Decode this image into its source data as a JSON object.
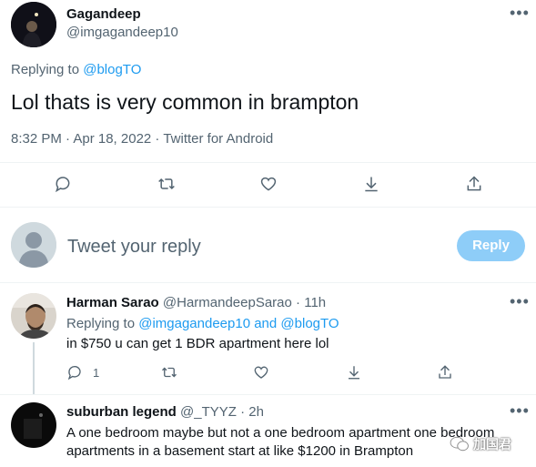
{
  "main_tweet": {
    "display_name": "Gagandeep",
    "handle": "@imgagandeep10",
    "replying_prefix": "Replying to",
    "replying_to": "@blogTO",
    "text": "Lol thats is very common in brampton",
    "meta": "8:32 PM · Apr 18, 2022 · Twitter for Android"
  },
  "composer": {
    "placeholder": "Tweet your reply",
    "button_label": "Reply"
  },
  "replies": [
    {
      "display_name": "Harman Sarao",
      "handle": "@HarmandeepSarao",
      "time": "· 11h",
      "replying_prefix": "Replying to",
      "replying_to_1": "@imgagandeep10",
      "replying_and": "and",
      "replying_to_2": "@blogTO",
      "text": "in $750 u can get 1 BDR apartment here lol",
      "reply_count": "1"
    },
    {
      "display_name": "suburban legend",
      "handle": "@_TYYZ",
      "time": "· 2h",
      "text": "A one bedroom maybe but not a one bedroom apartment one bedroom apartments in a basement start at like $1200 in Brampton"
    }
  ],
  "watermark": "加国君",
  "colors": {
    "accent": "#1d9bf0",
    "reply_button_disabled": "#8ecdf8",
    "secondary_text": "#536471",
    "divider": "#eff3f4"
  }
}
